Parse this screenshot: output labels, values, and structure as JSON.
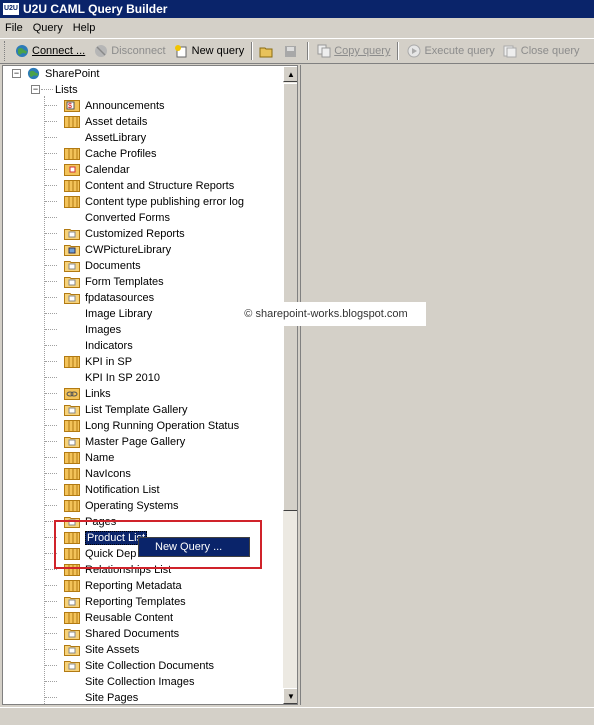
{
  "window": {
    "title": "U2U CAML Query Builder",
    "logo_text": "U2U"
  },
  "menu": {
    "items": [
      "File",
      "Query",
      "Help"
    ]
  },
  "toolbar": {
    "connect": "Connect ...",
    "disconnect": "Disconnect",
    "new_query": "New query",
    "copy_query": "Copy query",
    "execute_query": "Execute query",
    "close_query": "Close query"
  },
  "tree": {
    "root": "SharePoint",
    "lists_label": "Lists",
    "items": [
      {
        "label": "Announcements",
        "icon": "announcements-icon"
      },
      {
        "label": "Asset details",
        "icon": "list-icon"
      },
      {
        "label": "AssetLibrary",
        "icon": "none"
      },
      {
        "label": "Cache Profiles",
        "icon": "list-icon"
      },
      {
        "label": "Calendar",
        "icon": "calendar-icon"
      },
      {
        "label": "Content and Structure Reports",
        "icon": "list-icon"
      },
      {
        "label": "Content type publishing error log",
        "icon": "list-icon"
      },
      {
        "label": "Converted Forms",
        "icon": "none"
      },
      {
        "label": "Customized Reports",
        "icon": "library-icon"
      },
      {
        "label": "CWPictureLibrary",
        "icon": "picture-library-icon"
      },
      {
        "label": "Documents",
        "icon": "library-icon"
      },
      {
        "label": "Form Templates",
        "icon": "library-icon"
      },
      {
        "label": "fpdatasources",
        "icon": "library-icon"
      },
      {
        "label": "Image Library",
        "icon": "none"
      },
      {
        "label": "Images",
        "icon": "none"
      },
      {
        "label": "Indicators",
        "icon": "none"
      },
      {
        "label": "KPI in SP",
        "icon": "list-icon"
      },
      {
        "label": "KPI In SP 2010",
        "icon": "none"
      },
      {
        "label": "Links",
        "icon": "links-icon"
      },
      {
        "label": "List Template Gallery",
        "icon": "library-icon"
      },
      {
        "label": "Long Running Operation Status",
        "icon": "list-icon"
      },
      {
        "label": "Master Page Gallery",
        "icon": "library-icon"
      },
      {
        "label": "Name",
        "icon": "list-icon"
      },
      {
        "label": "NavIcons",
        "icon": "list-icon"
      },
      {
        "label": "Notification List",
        "icon": "list-icon"
      },
      {
        "label": "Operating Systems",
        "icon": "list-icon"
      },
      {
        "label": "Pages",
        "icon": "library-icon"
      },
      {
        "label": "Product List",
        "icon": "list-icon"
      },
      {
        "label": "Quick Dep",
        "icon": "list-icon"
      },
      {
        "label": "Relationships List",
        "icon": "list-icon"
      },
      {
        "label": "Reporting Metadata",
        "icon": "list-icon"
      },
      {
        "label": "Reporting Templates",
        "icon": "library-icon"
      },
      {
        "label": "Reusable Content",
        "icon": "list-icon"
      },
      {
        "label": "Shared Documents",
        "icon": "library-icon"
      },
      {
        "label": "Site Assets",
        "icon": "library-icon"
      },
      {
        "label": "Site Collection Documents",
        "icon": "library-icon"
      },
      {
        "label": "Site Collection Images",
        "icon": "none"
      },
      {
        "label": "Site Pages",
        "icon": "none"
      }
    ]
  },
  "context_menu": {
    "item": "New Query ..."
  },
  "watermark": "© sharepoint-works.blogspot.com",
  "colors": {
    "titlebar": "#0a246a",
    "highlight": "#0a246a",
    "red_box": "#d0232a"
  }
}
